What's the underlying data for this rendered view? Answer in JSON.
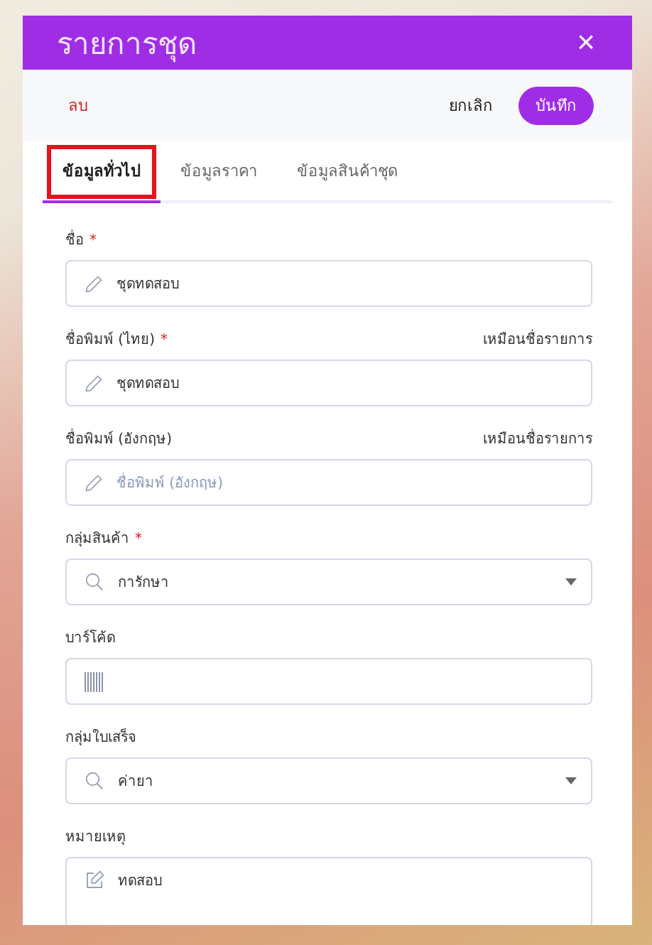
{
  "dialog": {
    "title": "รายการชุด",
    "close": "×"
  },
  "toolbar": {
    "delete": "ลบ",
    "cancel": "ยกเลิก",
    "save": "บันทึก"
  },
  "tabs": [
    {
      "label": "ข้อมูลทั่วไป",
      "selected": true
    },
    {
      "label": "ข้อมูลราคา",
      "selected": false
    },
    {
      "label": "ข้อมูลสินค้าชุด",
      "selected": false
    }
  ],
  "fields": [
    {
      "kind": "text",
      "label": "ชื่อ",
      "required_mark": "*",
      "value": "ชุดทดสอบ"
    },
    {
      "kind": "text",
      "label": "ชื่อพิมพ์ (ไทย)",
      "required_mark": "*",
      "aside": "เหมือนชื่อรายการ",
      "value": "ชุดทดสอบ"
    },
    {
      "kind": "text",
      "label": "ชื่อพิมพ์ (อังกฤษ)",
      "aside": "เหมือนชื่อรายการ",
      "placeholder": "ชื่อพิมพ์ (อังกฤษ)"
    },
    {
      "kind": "select",
      "label": "กลุ่มสินค้า",
      "required_mark": "*",
      "value": "การักษา"
    },
    {
      "kind": "barcode",
      "label": "บาร์โค้ด"
    },
    {
      "kind": "select",
      "label": "กลุ่มใบเสร็จ",
      "value": "ค่ายา"
    },
    {
      "kind": "textarea",
      "label": "หมายเหตุ",
      "value": "ทดสอบ"
    }
  ]
}
